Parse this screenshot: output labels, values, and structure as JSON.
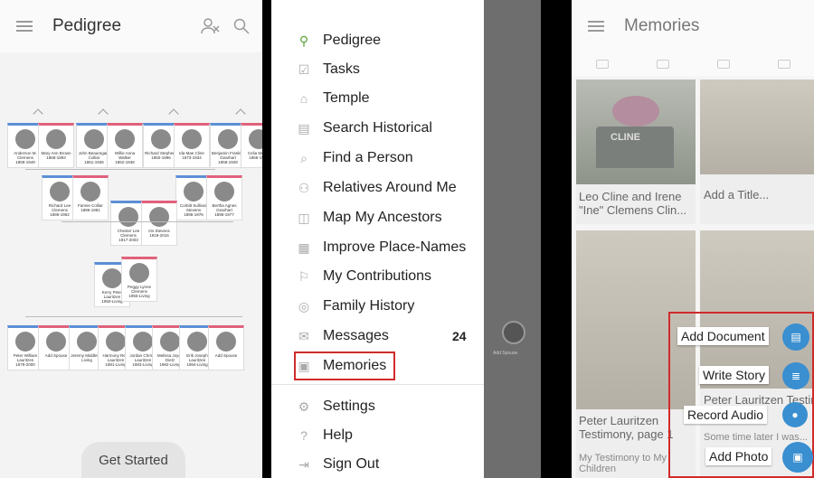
{
  "pedigree": {
    "title": "Pedigree",
    "get_started": "Get Started",
    "gen1": [
      {
        "name": "Anderson M. Clemens",
        "dates": "1859-1949"
      },
      {
        "name": "Mary Ann Brown",
        "dates": "1868-1893"
      },
      {
        "name": "John Beauregard Colliar",
        "dates": "1861-1936"
      },
      {
        "name": "Willie Anna Walker",
        "dates": "1862-1938"
      },
      {
        "name": "Richard Stephens",
        "dates": "1850-1896"
      },
      {
        "name": "Ida Mae Cline",
        "dates": "1873-1934"
      },
      {
        "name": "Benjamin Franklin Gearhart",
        "dates": "1858-1929"
      },
      {
        "name": "Celia Moore",
        "dates": "1866-1941"
      }
    ],
    "gen2": [
      {
        "name": "Richard Lee Clemens",
        "dates": "1886-1962"
      },
      {
        "name": "Fannie Colliar",
        "dates": "1886-1981"
      },
      {
        "name": "Corbitt Sullivan Stevens",
        "dates": "1896-1976"
      },
      {
        "name": "Bertha Agnes Gearhart",
        "dates": "1896-1977"
      }
    ],
    "gen3": [
      {
        "name": "Chester Lee Clemens",
        "dates": "1917-2003"
      },
      {
        "name": "Iris Stevens",
        "dates": "1918-2016"
      }
    ],
    "root": [
      {
        "name": "Kerry Peter Lauritzen",
        "dates": "1950-Living"
      },
      {
        "name": "Peggy Lynne Clemens",
        "dates": "1955-Living"
      }
    ],
    "children": [
      {
        "name": "Peter William Lauritzen",
        "dates": "1979-2000"
      },
      {
        "name": "Add Spouse",
        "dates": ""
      },
      {
        "name": "Jeremy Middleton",
        "dates": "Living"
      },
      {
        "name": "Harmony Re... Lauritzen",
        "dates": "1981-Living"
      },
      {
        "name": "Jordan Chris... Lauritzen",
        "dates": "1983-Living"
      },
      {
        "name": "Melissa Joyce Dietz",
        "dates": "1982-Living"
      },
      {
        "name": "Erik Joseph Lauritzen",
        "dates": "1984-Living"
      },
      {
        "name": "Add Spouse",
        "dates": ""
      }
    ]
  },
  "menu": {
    "items": [
      {
        "label": "Pedigree",
        "icon": "pedigree-icon"
      },
      {
        "label": "Tasks",
        "icon": "tasks-icon"
      },
      {
        "label": "Temple",
        "icon": "temple-icon"
      },
      {
        "label": "Search Historical",
        "icon": "search-historical-icon"
      },
      {
        "label": "Find a Person",
        "icon": "search-icon"
      },
      {
        "label": "Relatives Around Me",
        "icon": "relatives-icon"
      },
      {
        "label": "Map My Ancestors",
        "icon": "map-icon"
      },
      {
        "label": "Improve Place-Names",
        "icon": "place-names-icon"
      },
      {
        "label": "My Contributions",
        "icon": "contributions-icon"
      },
      {
        "label": "Family History",
        "icon": "family-history-icon"
      },
      {
        "label": "Messages",
        "icon": "messages-icon"
      },
      {
        "label": "Memories",
        "icon": "memories-icon"
      },
      {
        "label": "Settings",
        "icon": "gear-icon"
      },
      {
        "label": "Help",
        "icon": "help-icon"
      },
      {
        "label": "Sign Out",
        "icon": "sign-out-icon"
      }
    ],
    "messages_count": "24",
    "bg_add_spouse": "Add Spouse"
  },
  "memories": {
    "title": "Memories",
    "tiles": [
      {
        "caption": "Leo Cline and Irene \"Ine\" Clemens Clin...",
        "stone": "CLINE"
      },
      {
        "caption": "Add a Title..."
      },
      {
        "caption": "Peter Lauritzen Testimony, page 1",
        "sub": "My Testimony to My Children"
      },
      {
        "caption": "Peter Lauritzen Testimony, pa...",
        "sub": "Some time later I was..."
      }
    ],
    "actions": [
      {
        "label": "Add Document",
        "icon": "document-icon"
      },
      {
        "label": "Write Story",
        "icon": "story-icon"
      },
      {
        "label": "Record Audio",
        "icon": "microphone-icon"
      },
      {
        "label": "Add Photo",
        "icon": "photo-icon"
      }
    ]
  },
  "colors": {
    "accent": "#3a8fd0",
    "highlight": "#d02b2b",
    "male": "#5c8fd6",
    "female": "#e0617b",
    "green": "#5aa23b"
  }
}
